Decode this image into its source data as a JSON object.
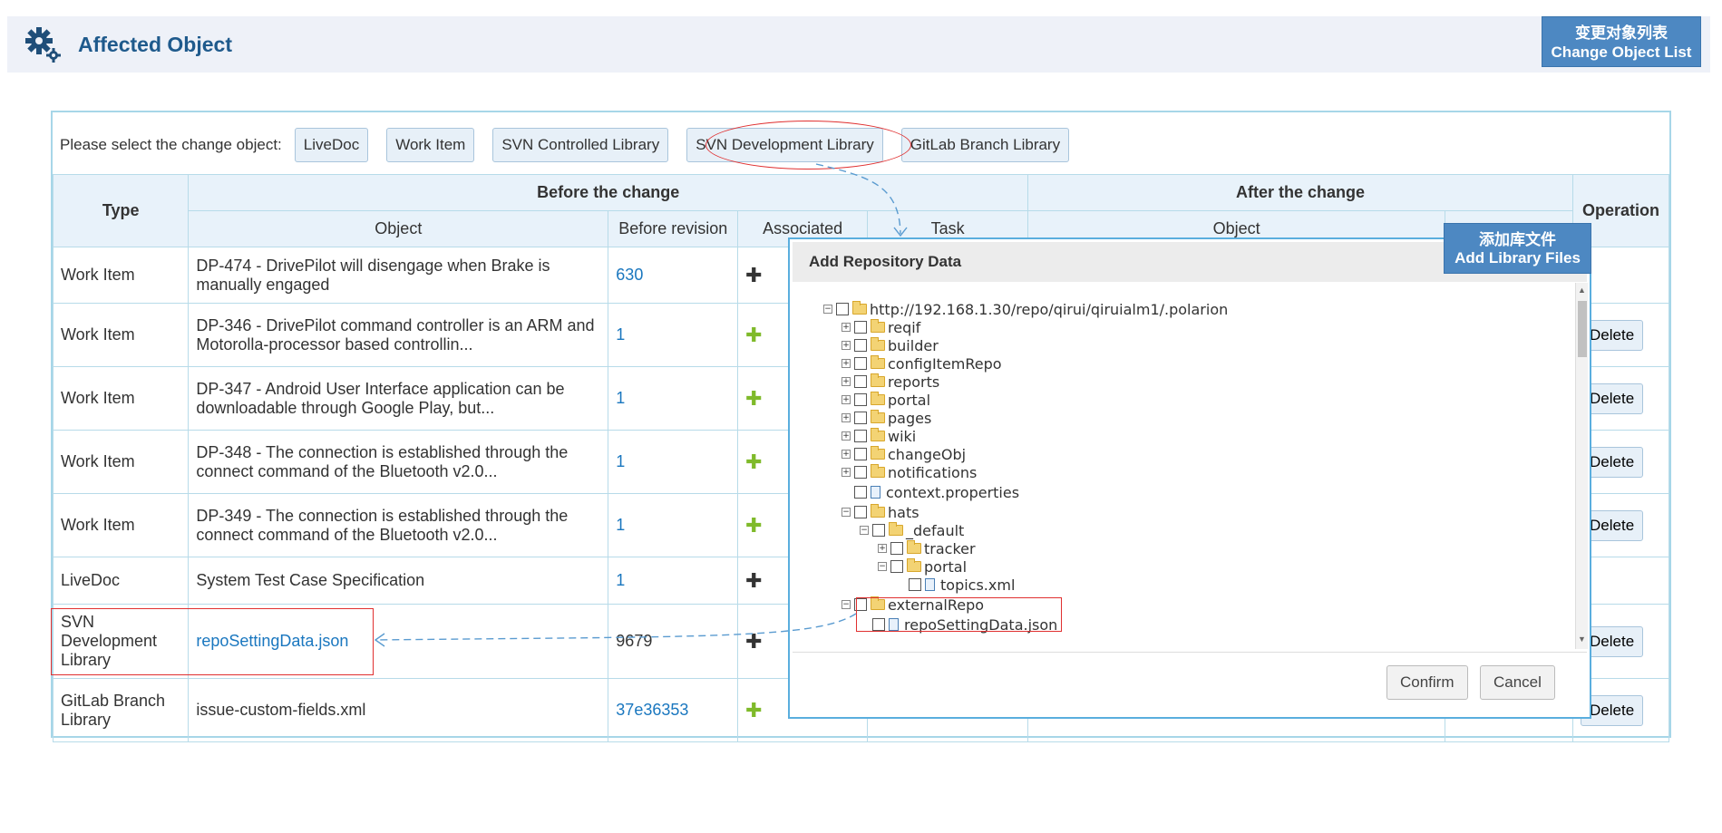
{
  "header": {
    "title": "Affected Object",
    "list_label_cn": "变更对象列表",
    "list_label_en": "Change Object List"
  },
  "selector": {
    "label": "Please select the change object:",
    "buttons": [
      "LiveDoc",
      "Work Item",
      "SVN Controlled Library",
      "SVN Development Library",
      "GitLab Branch Library"
    ]
  },
  "table": {
    "headers": {
      "type": "Type",
      "before": "Before the change",
      "after": "After the change",
      "operation": "Operation",
      "object": "Object",
      "before_revision": "Before revision",
      "associated": "Associated",
      "task": "Task",
      "after_object": "Object"
    },
    "rows": [
      {
        "type": "Work Item",
        "id": "DP-474",
        "text": " - DrivePilot will disengage when Brake is manually engaged",
        "revision": "630",
        "plus": "dark",
        "op": ""
      },
      {
        "type": "Work Item",
        "id": "DP-346",
        "text": " - DrivePilot command controller is an ARM and Motorolla-processor based controllin...",
        "revision": "1",
        "plus": "green",
        "op": "Delete"
      },
      {
        "type": "Work Item",
        "id": "DP-347",
        "text": " - Android User Interface application can be downloadable through Google Play, but...",
        "revision": "1",
        "plus": "green",
        "op": "Delete"
      },
      {
        "type": "Work Item",
        "id": "DP-348",
        "text": " - The connection is established through the connect command of the Bluetooth v2.0...",
        "revision": "1",
        "plus": "green",
        "op": "Delete"
      },
      {
        "type": "Work Item",
        "id": "DP-349",
        "text": " - The connection is established through the connect command of the Bluetooth v2.0...",
        "revision": "1",
        "plus": "green",
        "op": "Delete"
      },
      {
        "type": "LiveDoc",
        "id": "",
        "text": "System Test Case Specification",
        "revision": "1",
        "plus": "dark",
        "op": ""
      },
      {
        "type": "SVN Development Library",
        "id": "",
        "text": "repoSettingData.json",
        "revision": "9679",
        "plus": "dark",
        "op": "Delete"
      },
      {
        "type": "GitLab Branch Library",
        "id": "",
        "text": "issue-custom-fields.xml",
        "revision": "37e36353",
        "plus": "green",
        "op": "Delete"
      }
    ]
  },
  "modal": {
    "title": "Add Repository Data",
    "badge_cn": "添加库文件",
    "badge_en": "Add Library Files",
    "tree": [
      {
        "label": "http://192.168.1.30/repo/qirui/qiruialm1/.polarion",
        "level": 0,
        "kind": "folder",
        "toggle": "−"
      },
      {
        "label": "reqif",
        "level": 1,
        "kind": "folder",
        "toggle": "+"
      },
      {
        "label": "builder",
        "level": 1,
        "kind": "folder",
        "toggle": "+"
      },
      {
        "label": "configItemRepo",
        "level": 1,
        "kind": "folder",
        "toggle": "+"
      },
      {
        "label": "reports",
        "level": 1,
        "kind": "folder",
        "toggle": "+"
      },
      {
        "label": "portal",
        "level": 1,
        "kind": "folder",
        "toggle": "+"
      },
      {
        "label": "pages",
        "level": 1,
        "kind": "folder",
        "toggle": "+"
      },
      {
        "label": "wiki",
        "level": 1,
        "kind": "folder",
        "toggle": "+"
      },
      {
        "label": "changeObj",
        "level": 1,
        "kind": "folder",
        "toggle": "+"
      },
      {
        "label": "notifications",
        "level": 1,
        "kind": "folder",
        "toggle": "+"
      },
      {
        "label": "context.properties",
        "level": 1,
        "kind": "file",
        "toggle": ""
      },
      {
        "label": "hats",
        "level": 1,
        "kind": "folder",
        "toggle": "−"
      },
      {
        "label": "_default",
        "level": 2,
        "kind": "folder",
        "toggle": "−"
      },
      {
        "label": "tracker",
        "level": 3,
        "kind": "folder",
        "toggle": "+"
      },
      {
        "label": "portal",
        "level": 3,
        "kind": "folder",
        "toggle": "−"
      },
      {
        "label": "topics.xml",
        "level": 4,
        "kind": "file",
        "toggle": ""
      },
      {
        "label": "externalRepo",
        "level": 1,
        "kind": "folder",
        "toggle": "−"
      },
      {
        "label": "repoSettingData.json",
        "level": 2,
        "kind": "file",
        "toggle": ""
      }
    ],
    "confirm": "Confirm",
    "cancel": "Cancel"
  }
}
